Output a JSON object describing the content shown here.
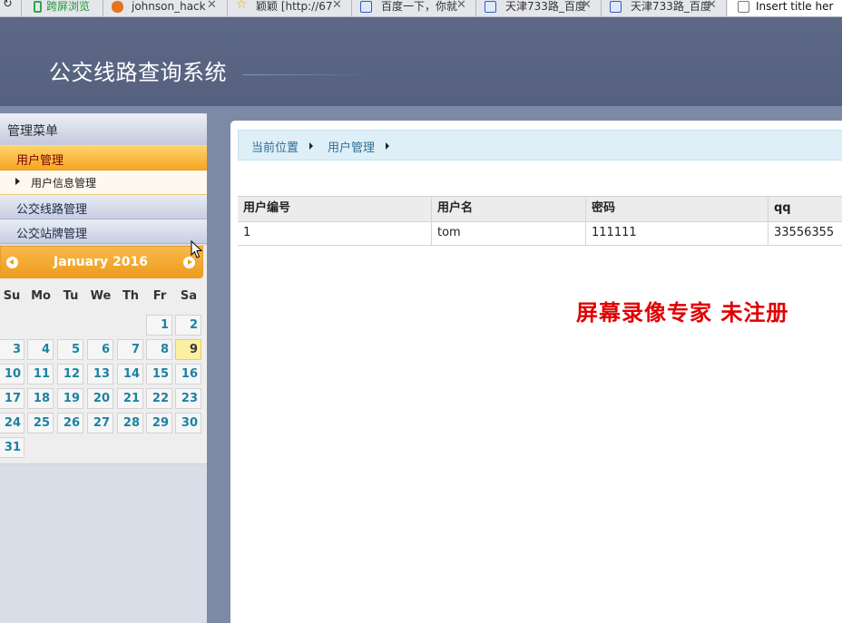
{
  "browser": {
    "tabs": [
      {
        "label": "跨屏浏览",
        "icon": "green-phone-icon"
      },
      {
        "label": "johnson_hack",
        "icon": "blog-icon"
      },
      {
        "label": "颖颖 [http://67",
        "icon": "star-icon"
      },
      {
        "label": "百度一下，你就",
        "icon": "baidu-paw-icon"
      },
      {
        "label": "天津733路_百度",
        "icon": "baidu-paw-icon"
      },
      {
        "label": "天津733路_百度",
        "icon": "baidu-paw-icon"
      },
      {
        "label": "Insert title her",
        "icon": "page-icon",
        "active": true
      }
    ]
  },
  "header": {
    "title": "公交线路查询系统"
  },
  "menu": {
    "title": "管理菜单",
    "groups": [
      {
        "label": "用户管理",
        "active": true,
        "items": [
          {
            "label": "用户信息管理"
          }
        ]
      },
      {
        "label": "公交线路管理"
      },
      {
        "label": "公交站牌管理"
      }
    ]
  },
  "calendar": {
    "month_label": "January 2016",
    "weekdays": [
      "Su",
      "Mo",
      "Tu",
      "We",
      "Th",
      "Fr",
      "Sa"
    ],
    "first_weekday_index": 5,
    "days_in_month": 31,
    "today": 9,
    "accent_color": "#f6a623"
  },
  "breadcrumb": {
    "items": [
      "当前位置",
      "用户管理"
    ]
  },
  "table": {
    "columns": [
      "用户编号",
      "用户名",
      "密码",
      "qq"
    ],
    "rows": [
      [
        "1",
        "tom",
        "111111",
        "33556355"
      ]
    ]
  },
  "watermark": {
    "text": "屏幕录像专家  未注册",
    "color": "#e00000"
  }
}
